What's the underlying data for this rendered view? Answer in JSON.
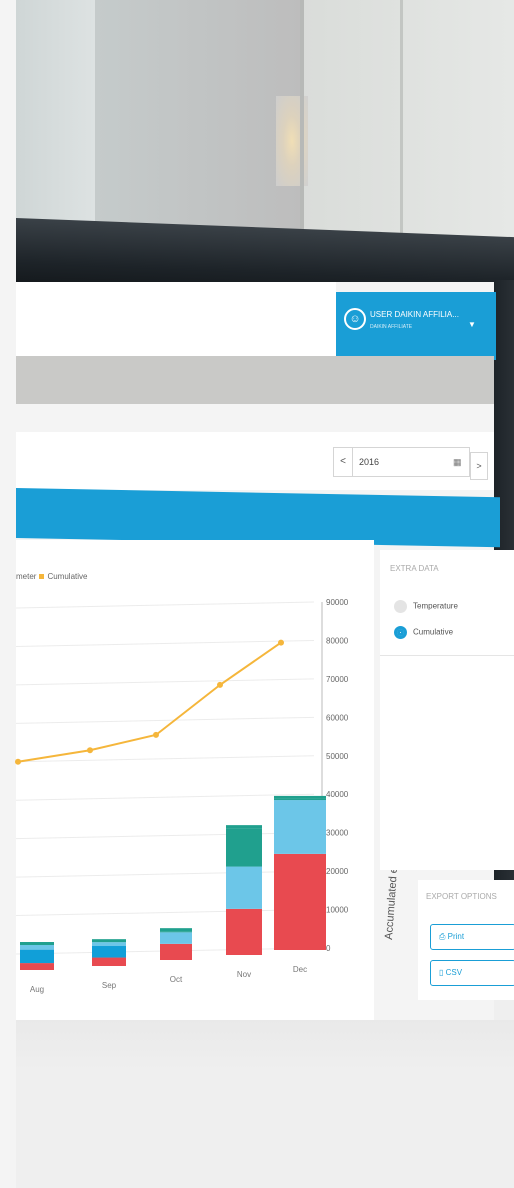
{
  "header": {
    "user_name": "USER DAIKIN AFFILIA...",
    "user_role": "DAIKIN AFFILIATE",
    "avatar_glyph": "☺",
    "caret_glyph": "▼"
  },
  "toolbar": {
    "prev_label": "<",
    "year_value": "2016",
    "calendar_glyph": "▦",
    "next_label": ">"
  },
  "chart_legend": {
    "meter_label": "meter",
    "cumulative_label": "Cumulative"
  },
  "extra_data": {
    "title": "EXTRA DATA",
    "options": [
      {
        "label": "Temperature",
        "selected": false
      },
      {
        "label": "Cumulative",
        "selected": true
      }
    ]
  },
  "export_options": {
    "title": "EXPORT OPTIONS",
    "print_label": "Print",
    "csv_label": "CSV"
  },
  "colors": {
    "accent": "#1a9ed6",
    "bar_blue": "#119fd8",
    "bar_light_blue": "#6cc6e8",
    "bar_red": "#e84a50",
    "bar_teal": "#20a08e",
    "line": "#f5b63b"
  },
  "chart_data": {
    "type": "bar",
    "categories": [
      "Aug",
      "Sep",
      "Oct",
      "Nov",
      "Dec"
    ],
    "series": [
      {
        "name": "",
        "values": [
          1800,
          2200,
          4200,
          12000,
          25000
        ],
        "kind": "red"
      },
      {
        "name": "",
        "values": [
          3500,
          3000,
          3000,
          11000,
          14000
        ],
        "kind": "blue"
      },
      {
        "name": "",
        "values": [
          1200,
          1000,
          300,
          10000,
          300
        ],
        "kind": "teal"
      }
    ],
    "cumulative": {
      "name": "Cumulative",
      "values": [
        50000,
        53000,
        57000,
        70000,
        81000
      ]
    },
    "y2label": "Accumulated energy consumption (kWh)",
    "y2ticks": [
      0,
      10000,
      20000,
      30000,
      40000,
      50000,
      60000,
      70000,
      80000,
      90000
    ],
    "y2lim": [
      0,
      90000
    ],
    "grid": true,
    "legend": "top-left"
  }
}
